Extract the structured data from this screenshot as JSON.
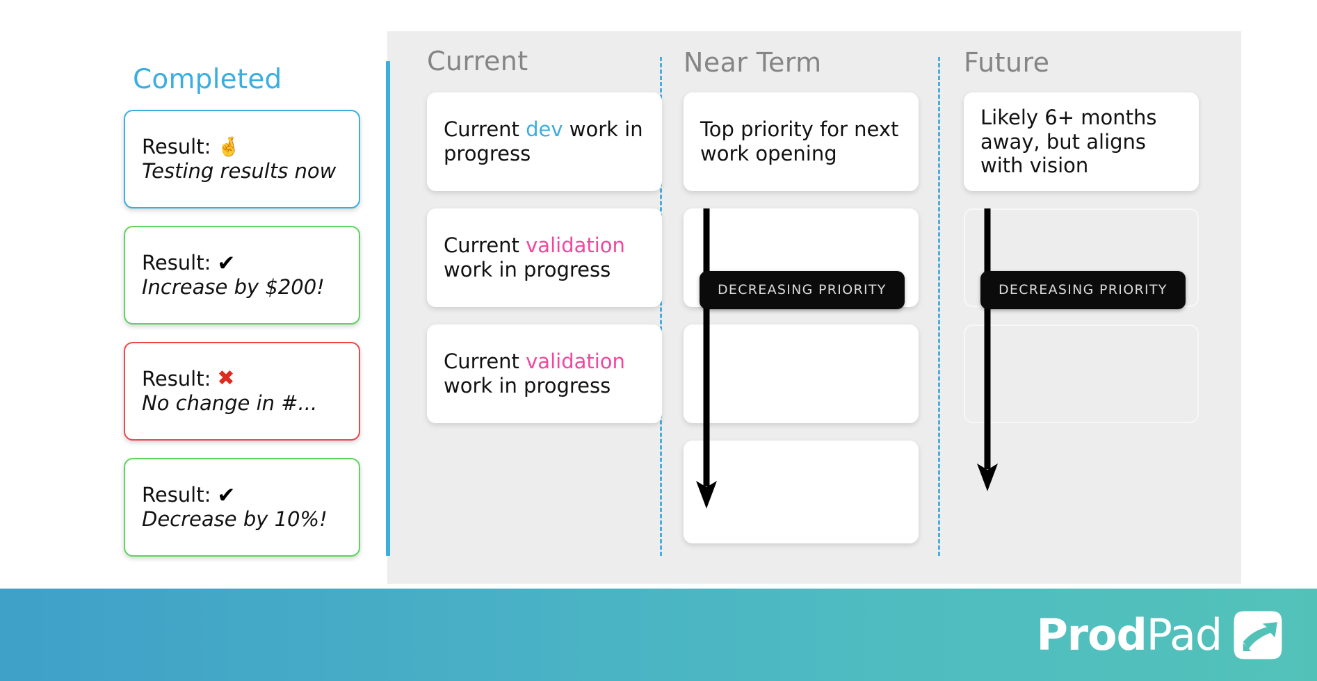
{
  "completed": {
    "title": "Completed",
    "cards": [
      {
        "label": "Result:",
        "icon": "crossed-fingers",
        "icon_glyph": "🤞",
        "accent": "blue",
        "accent_hex": "#3BAEE0",
        "detail": "Testing results now"
      },
      {
        "label": "Result:",
        "icon": "check-mark",
        "icon_glyph": "✔",
        "accent": "green",
        "accent_hex": "#5ED55E",
        "detail": "Increase by $200!"
      },
      {
        "label": "Result:",
        "icon": "cross-mark",
        "icon_glyph": "✖",
        "accent": "red",
        "accent_hex": "#F0474B",
        "detail": "No change in #..."
      },
      {
        "label": "Result:",
        "icon": "check-mark",
        "icon_glyph": "✔",
        "accent": "green",
        "accent_hex": "#5ED55E",
        "detail": "Decrease by 10%!"
      }
    ]
  },
  "board": {
    "columns": [
      {
        "id": "current",
        "title": "Current",
        "cards": [
          {
            "pre": "Current ",
            "token": "dev",
            "token_kind": "dev",
            "post": " work in progress",
            "empty": false,
            "ghost": false
          },
          {
            "pre": "Current ",
            "token": "validation",
            "token_kind": "val",
            "post": " work in progress",
            "empty": false,
            "ghost": false
          },
          {
            "pre": "Current ",
            "token": "validation",
            "token_kind": "val",
            "post": " work in progress",
            "empty": false,
            "ghost": false
          }
        ]
      },
      {
        "id": "near-term",
        "title": "Near Term",
        "cards": [
          {
            "pre": "Top priority for next work opening",
            "token": "",
            "token_kind": "",
            "post": "",
            "empty": false,
            "ghost": false
          },
          {
            "pre": "",
            "token": "",
            "token_kind": "",
            "post": "",
            "empty": true,
            "ghost": false
          },
          {
            "pre": "",
            "token": "",
            "token_kind": "",
            "post": "",
            "empty": true,
            "ghost": false
          },
          {
            "pre": "",
            "token": "",
            "token_kind": "",
            "post": "",
            "empty": true,
            "ghost": false
          }
        ]
      },
      {
        "id": "future",
        "title": "Future",
        "cards": [
          {
            "pre": "Likely 6+ months away, but aligns with vision",
            "token": "",
            "token_kind": "",
            "post": "",
            "empty": false,
            "ghost": false
          },
          {
            "pre": "",
            "token": "",
            "token_kind": "",
            "post": "",
            "empty": true,
            "ghost": true
          },
          {
            "pre": "",
            "token": "",
            "token_kind": "",
            "post": "",
            "empty": true,
            "ghost": true
          }
        ]
      }
    ],
    "priority_badges": [
      {
        "id": "near-term",
        "label": "DECREASING PRIORITY"
      },
      {
        "id": "future",
        "label": "DECREASING PRIORITY"
      }
    ]
  },
  "footer": {
    "logo_prod": "Prod",
    "logo_pad": "Pad",
    "gradient_from": "#3FA0C8",
    "gradient_to": "#52C2B9"
  },
  "colors": {
    "accent_blue": "#3BAEE0",
    "accent_pink": "#F2479E",
    "accent_green": "#5ED55E",
    "accent_red": "#F0474B",
    "board_bg": "#EDEDED",
    "badge_bg": "#0B0B0B",
    "column_title": "#858585"
  }
}
